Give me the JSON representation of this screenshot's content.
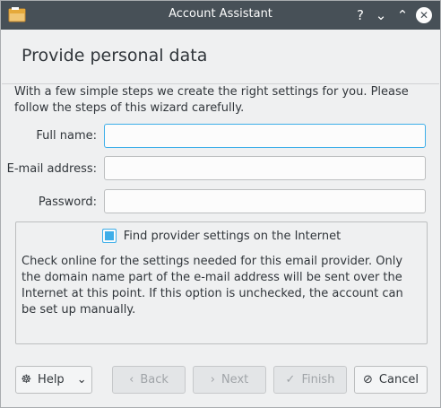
{
  "window": {
    "title": "Account Assistant"
  },
  "titlebar_icons": [
    "wallet-icon",
    "help-icon",
    "minimize-icon",
    "maximize-icon",
    "close-icon"
  ],
  "titlebar_glyphs": {
    "help": "?",
    "minimize": "⌄",
    "maximize": "⌃",
    "close": "✕"
  },
  "page": {
    "title": "Provide personal data",
    "intro": "With a few simple steps we create the right settings for you. Please follow the steps of this wizard carefully."
  },
  "form": {
    "full_name_label": "Full name:",
    "full_name_value": "",
    "email_label": "E-mail address:",
    "email_value": "",
    "password_label": "Password:",
    "password_value": ""
  },
  "provider": {
    "checkbox_label": "Find provider settings on the Internet",
    "checked": true,
    "help": "Check online for the settings needed for this email provider. Only the domain name part of the e-mail address will be sent over the Internet at this point. If this option is unchecked, the account can be set up manually."
  },
  "buttons": {
    "help": "Help",
    "back": "Back",
    "next": "Next",
    "finish": "Finish",
    "cancel": "Cancel"
  },
  "button_glyphs": {
    "help": "☸",
    "help_menu": "⌄",
    "back": "‹",
    "next": "›",
    "finish": "✓",
    "cancel": "⊘"
  },
  "colors": {
    "titlebar": "#475057",
    "accent": "#3daee9",
    "background": "#eff0f1"
  }
}
